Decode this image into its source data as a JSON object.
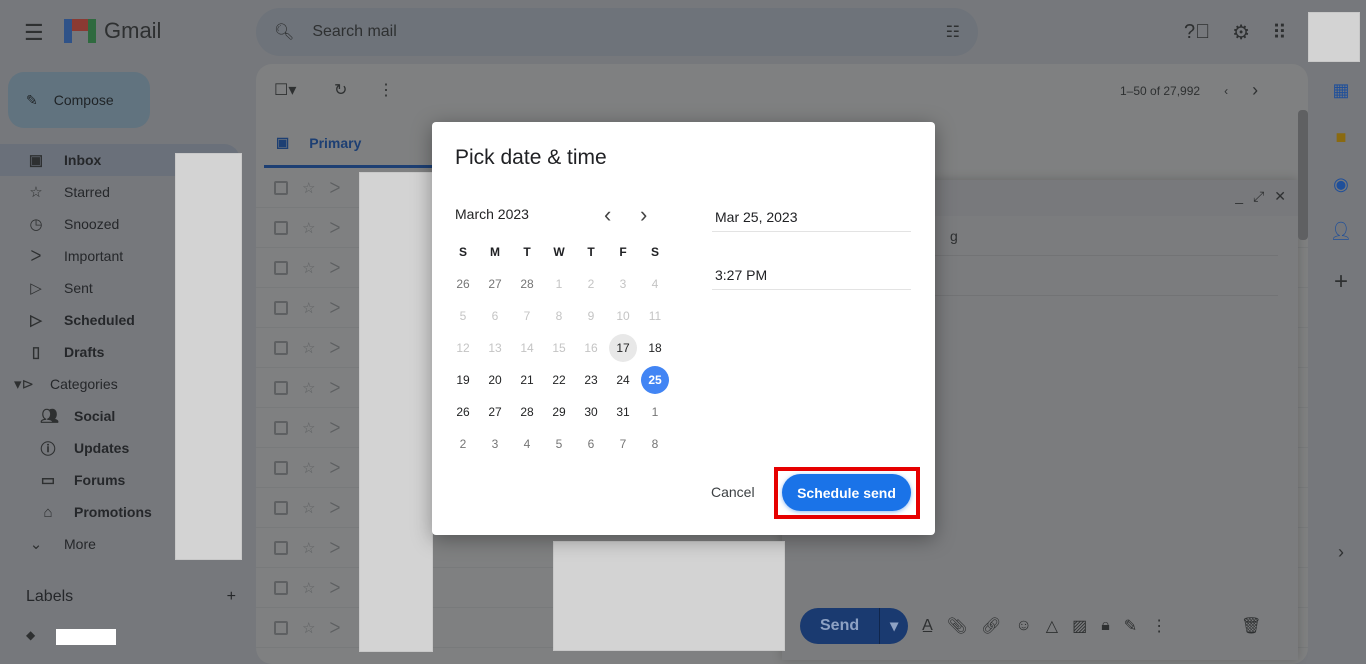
{
  "header": {
    "app_name": "Gmail",
    "search_placeholder": "Search mail"
  },
  "sidebar": {
    "compose": "Compose",
    "items": [
      {
        "label": "Inbox",
        "icon": "inbox-icon"
      },
      {
        "label": "Starred",
        "icon": "star-icon"
      },
      {
        "label": "Snoozed",
        "icon": "clock-icon"
      },
      {
        "label": "Important",
        "icon": "label-important-icon"
      },
      {
        "label": "Sent",
        "icon": "send-icon"
      },
      {
        "label": "Scheduled",
        "icon": "scheduled-icon"
      },
      {
        "label": "Drafts",
        "icon": "draft-icon"
      },
      {
        "label": "Categories",
        "icon": "label-icon"
      },
      {
        "label": "Social",
        "icon": "people-icon"
      },
      {
        "label": "Updates",
        "icon": "info-icon"
      },
      {
        "label": "Forums",
        "icon": "forum-icon"
      },
      {
        "label": "Promotions",
        "icon": "tag-icon"
      },
      {
        "label": "More",
        "icon": "chevron-down-icon"
      }
    ],
    "labels_heading": "Labels"
  },
  "toolbar": {
    "pagination": "1–50 of 27,992"
  },
  "tabs": {
    "primary": "Primary"
  },
  "compose_window": {
    "send": "Send",
    "subject_fragment": "g"
  },
  "dialog": {
    "title": "Pick date & time",
    "month": "March 2023",
    "weekdays": [
      "S",
      "M",
      "T",
      "W",
      "T",
      "F",
      "S"
    ],
    "days": [
      [
        "26",
        "27",
        "28",
        "1",
        "2",
        "3",
        "4"
      ],
      [
        "5",
        "6",
        "7",
        "8",
        "9",
        "10",
        "11"
      ],
      [
        "12",
        "13",
        "14",
        "15",
        "16",
        "17",
        "18"
      ],
      [
        "19",
        "20",
        "21",
        "22",
        "23",
        "24",
        "25"
      ],
      [
        "26",
        "27",
        "28",
        "29",
        "30",
        "31",
        "1"
      ],
      [
        "2",
        "3",
        "4",
        "5",
        "6",
        "7",
        "8"
      ]
    ],
    "today": "17",
    "selected": "25",
    "date_value": "Mar 25, 2023",
    "time_value": "3:27 PM",
    "cancel": "Cancel",
    "schedule_send": "Schedule send"
  },
  "colors": {
    "accent": "#1a73e8",
    "selected_day": "#4285f4",
    "highlight": "#e60000"
  }
}
